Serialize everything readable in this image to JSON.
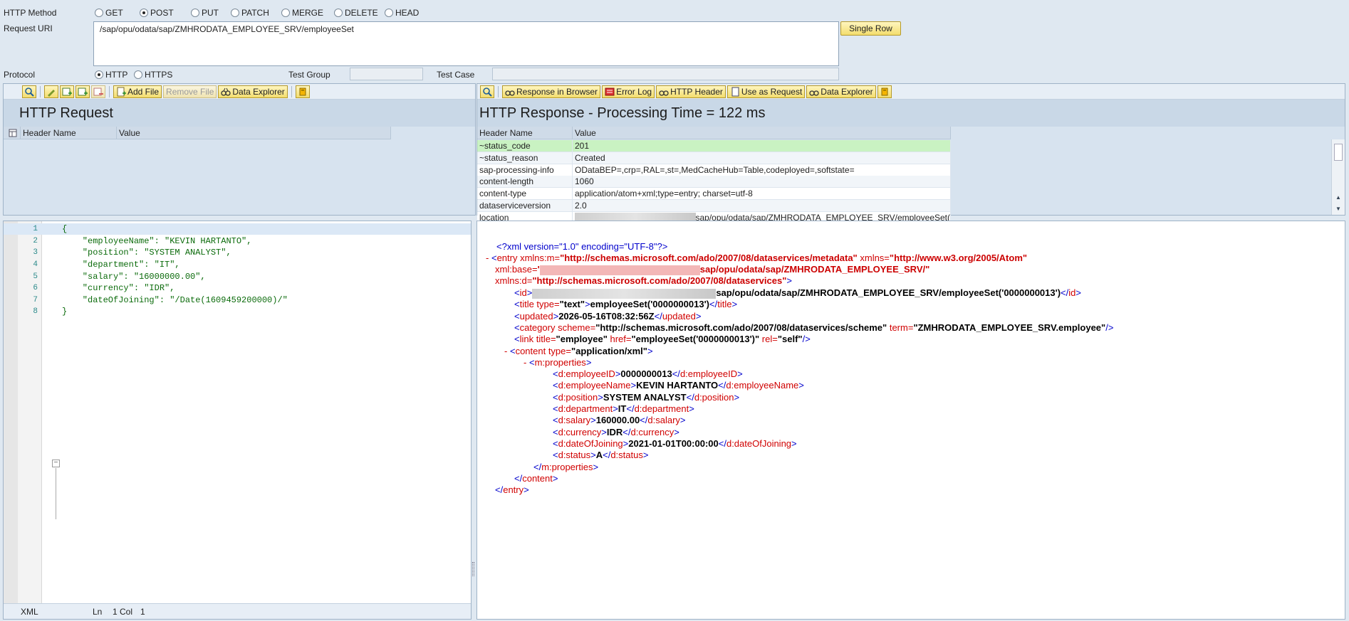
{
  "form": {
    "method_label": "HTTP Method",
    "methods": [
      "GET",
      "POST",
      "PUT",
      "PATCH",
      "MERGE",
      "DELETE",
      "HEAD"
    ],
    "selected_method": "POST",
    "uri_label": "Request URI",
    "uri_value": "/sap/opu/odata/sap/ZMHRODATA_EMPLOYEE_SRV/employeeSet",
    "single_row_label": "Single Row",
    "protocol_label": "Protocol",
    "protocols": [
      "HTTP",
      "HTTPS"
    ],
    "selected_protocol": "HTTP",
    "test_group_label": "Test Group",
    "test_case_label": "Test Case"
  },
  "request": {
    "toolbar": {
      "add_file": "Add File",
      "remove_file": "Remove File",
      "data_explorer": "Data Explorer"
    },
    "title": "HTTP Request",
    "col_name": "Header Name",
    "col_value": "Value",
    "body_lines": [
      "{",
      "    \"employeeName\": \"KEVIN HARTANTO\",",
      "    \"position\": \"SYSTEM ANALYST\",",
      "    \"department\": \"IT\",",
      "    \"salary\": \"16000000.00\",",
      "    \"currency\": \"IDR\",",
      "    \"dateOfJoining\": \"/Date(1609459200000)/\"",
      "}"
    ],
    "line_numbers": [
      "1",
      "2",
      "3",
      "4",
      "5",
      "6",
      "7",
      "8"
    ],
    "status_format": "XML",
    "status_ln": "Ln",
    "status_pos": "1 Col",
    "status_col": "1"
  },
  "response": {
    "toolbar": {
      "response_browser": "Response in Browser",
      "error_log": "Error Log",
      "http_header": "HTTP Header",
      "use_as_request": "Use as Request",
      "data_explorer": "Data Explorer"
    },
    "title_prefix": "HTTP Response - Processing Time = ",
    "processing_time": "122",
    "processing_unit": " ms",
    "col_name": "Header Name",
    "col_value": "Value",
    "headers": [
      {
        "name": "~status_code",
        "value": "201"
      },
      {
        "name": "~status_reason",
        "value": "Created"
      },
      {
        "name": "sap-processing-info",
        "value": "ODataBEP=,crp=,RAL=,st=,MedCacheHub=Table,codeployed=,softstate="
      },
      {
        "name": "content-length",
        "value": "1060"
      },
      {
        "name": "content-type",
        "value": "application/atom+xml;type=entry; charset=utf-8"
      },
      {
        "name": "dataserviceversion",
        "value": "2.0"
      },
      {
        "name": "location",
        "value": "sap/opu/odata/sap/ZMHRODATA_EMPLOYEE_SRV/employeeSet("
      }
    ]
  },
  "xml": {
    "decl": "<?xml version=\"1.0\" encoding=\"UTF-8\"?>",
    "ns_m_attr": "xmlns:m=",
    "ns_m": "\"http://schemas.microsoft.com/ado/2007/08/dataservices/metadata\"",
    "ns_attr": "xmlns=",
    "ns": "\"http://www.w3.org/2005/Atom\"",
    "base_attr": "xml:base=",
    "base_tail": "sap/opu/odata/sap/ZMHRODATA_EMPLOYEE_SRV/\"",
    "ns_d_attr": "xmlns:d=",
    "ns_d": "\"http://schemas.microsoft.com/ado/2007/08/dataservices\"",
    "id_tail": "sap/opu/odata/sap/ZMHRODATA_EMPLOYEE_SRV/employeeSet('0000000013')",
    "title_type": "\"text\"",
    "title_val": "employeeSet('0000000013')",
    "updated": "2026-05-16T08:32:56Z",
    "cat_scheme": "http://schemas.microsoft.com/ado/2007/08/dataservices/scheme",
    "cat_term": "ZMHRODATA_EMPLOYEE_SRV.employee",
    "link_title": "employee",
    "link_href": "employeeSet('0000000013')",
    "link_rel": "self",
    "content_type": "application/xml",
    "props": [
      {
        "tag": "d:employeeID",
        "value": "0000000013"
      },
      {
        "tag": "d:employeeName",
        "value": "KEVIN HARTANTO"
      },
      {
        "tag": "d:position",
        "value": "SYSTEM ANALYST"
      },
      {
        "tag": "d:department",
        "value": "IT"
      },
      {
        "tag": "d:salary",
        "value": "160000.00"
      },
      {
        "tag": "d:currency",
        "value": "IDR"
      },
      {
        "tag": "d:dateOfJoining",
        "value": "2021-01-01T00:00:00"
      },
      {
        "tag": "d:status",
        "value": "A"
      }
    ]
  }
}
